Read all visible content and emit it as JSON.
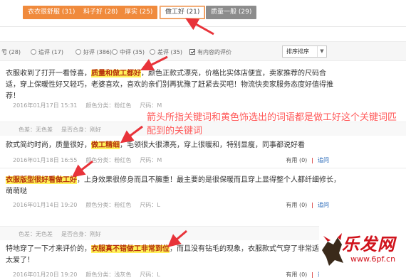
{
  "tags": [
    {
      "label": "衣衣很舒服 (31)",
      "style": "orange"
    },
    {
      "label": "料子好 (28)",
      "style": "orange"
    },
    {
      "label": "厚实 (25)",
      "style": "orange"
    },
    {
      "label": "做工好 (21)",
      "style": "active"
    },
    {
      "label": "质量一般 (29)",
      "style": "grey"
    }
  ],
  "filters": {
    "all_count": "(28)",
    "append": "追评 (17)",
    "good": "好评 (386)",
    "medium": "中评 (35)",
    "bad": "差评 (35)",
    "has_content": "有内容的评价",
    "sort": "排序排序"
  },
  "reviews": [
    {
      "pre": "衣服收到了打开一看惊喜，",
      "highlight": "质量和做工都好",
      "post": "，颜色正款式漂亮，价格比实体店便宜，卖家推荐的尺码合适，穿上保暖性好又轻巧，老婆喜欢，喜欢的亲们别再犹豫了赶紧去买吧！物流快卖家服务态度好值得推荐！",
      "date": "2016年01月17日 15:31",
      "color": "颜色分类：粉红色",
      "size": "尺码：M"
    },
    {
      "tag_color": "色差：无色差",
      "tag_fit": "是否合身：刚好",
      "pre": "款式简约时尚，质量很好，",
      "highlight": "做工精细",
      "post": "，毛领很大很漂亮，穿上很暖和，特别显瘦，同事都说好看",
      "date": "2016年01月18日 16:55",
      "color": "颜色分类：粉红色",
      "size": "尺码：M"
    },
    {
      "highlight": "衣服版型很好看做工好",
      "post": "，上身效果很修身而且不臃重！最主要的是很保暖而且穿上显得整个人都纤细修长，萌萌哒",
      "date": "2016年01月14日 19:20",
      "color": "颜色分类：粉红色",
      "size": "尺码：L"
    },
    {
      "tag_color": "色差：无色差",
      "tag_fit": "是否合身：刚好",
      "pre": "特地穿了一下才来评价的，",
      "highlight": "衣服真不错做工非常到位",
      "post": "，而且没有钻毛的现象，衣服款式气穿了非常适合，太爱了！",
      "date": "2016年01月20日 19:20",
      "color": "颜色分类：浅灰色",
      "size": "尺码：L"
    }
  ],
  "actions": {
    "useful": "有用 (0)",
    "reply": "追问"
  },
  "annotation": "箭头所指关键词和黄色饰选出的词语都是做工好这个关键词匹配到的关键词",
  "watermark": {
    "title": "乐发网",
    "url": "www.6pf.cn"
  },
  "colors": {
    "accent": "#f08a3c",
    "highlight": "#fff15a",
    "annotation": "#ff5a5a",
    "arrow": "#e8333a"
  }
}
